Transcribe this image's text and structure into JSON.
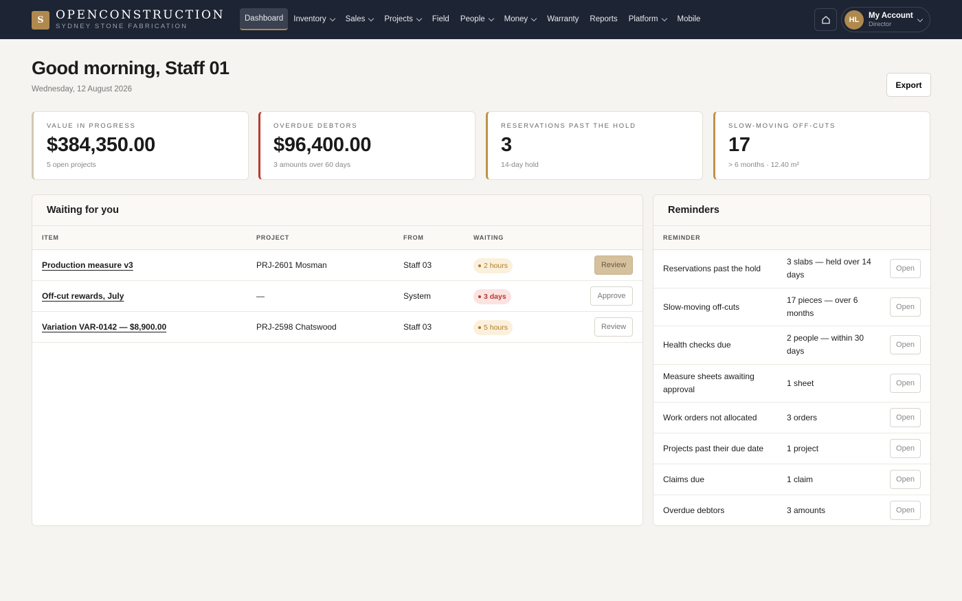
{
  "brand": {
    "mark": "S",
    "name": "OPENCONSTRUCTION",
    "subtitle": "SYDNEY STONE FABRICATION"
  },
  "nav": [
    {
      "label": "Dashboard",
      "active": true,
      "dropdown": false
    },
    {
      "label": "Inventory",
      "dropdown": true
    },
    {
      "label": "Sales",
      "dropdown": true
    },
    {
      "label": "Projects",
      "dropdown": true
    },
    {
      "label": "Field",
      "dropdown": false
    },
    {
      "label": "People",
      "dropdown": true
    },
    {
      "label": "Money",
      "dropdown": true
    },
    {
      "label": "Warranty",
      "dropdown": false
    },
    {
      "label": "Reports",
      "dropdown": false
    },
    {
      "label": "Platform",
      "dropdown": true
    },
    {
      "label": "Mobile",
      "dropdown": false
    }
  ],
  "account": {
    "initials": "HL",
    "name": "My Account",
    "role": "Director"
  },
  "header": {
    "greeting": "Good morning, Staff 01",
    "date": "Wednesday, 12 August 2026",
    "export_label": "Export"
  },
  "stats": [
    {
      "label": "VALUE IN PROGRESS",
      "value": "$384,350.00",
      "sub": "5 open projects"
    },
    {
      "label": "OVERDUE DEBTORS",
      "value": "$96,400.00",
      "sub": "3 amounts over 60 days"
    },
    {
      "label": "RESERVATIONS PAST THE HOLD",
      "value": "3",
      "sub": "14-day hold"
    },
    {
      "label": "SLOW-MOVING OFF-CUTS",
      "value": "17",
      "sub": "> 6 months · 12.40 m²"
    }
  ],
  "waiting": {
    "title": "Waiting for you",
    "columns": {
      "item": "ITEM",
      "project": "PROJECT",
      "from": "FROM",
      "waiting": "WAITING"
    },
    "rows": [
      {
        "item": "Production measure v3",
        "project": "PRJ-2601 Mosman",
        "from": "Staff 03",
        "waiting": "2 hours",
        "action": "Review"
      },
      {
        "item": "Off-cut rewards, July",
        "project": "—",
        "from": "System",
        "waiting": "3 days",
        "action": "Approve"
      },
      {
        "item": "Variation VAR-0142 — $8,900.00",
        "project": "PRJ-2598 Chatswood",
        "from": "Staff 03",
        "waiting": "5 hours",
        "action": "Review"
      }
    ]
  },
  "reminders": {
    "title": "Reminders",
    "column": "REMINDER",
    "open_label": "Open",
    "rows": [
      {
        "name": "Reservations past the hold",
        "value": "3 slabs — held over 14 days"
      },
      {
        "name": "Slow-moving off-cuts",
        "value": "17 pieces — over 6 months"
      },
      {
        "name": "Health checks due",
        "value": "2 people — within 30 days"
      },
      {
        "name": "Measure sheets awaiting approval",
        "value": "1 sheet"
      },
      {
        "name": "Work orders not allocated",
        "value": "3 orders"
      },
      {
        "name": "Projects past their due date",
        "value": "1 project"
      },
      {
        "name": "Claims due",
        "value": "1 claim"
      },
      {
        "name": "Overdue debtors",
        "value": "3 amounts"
      }
    ]
  }
}
